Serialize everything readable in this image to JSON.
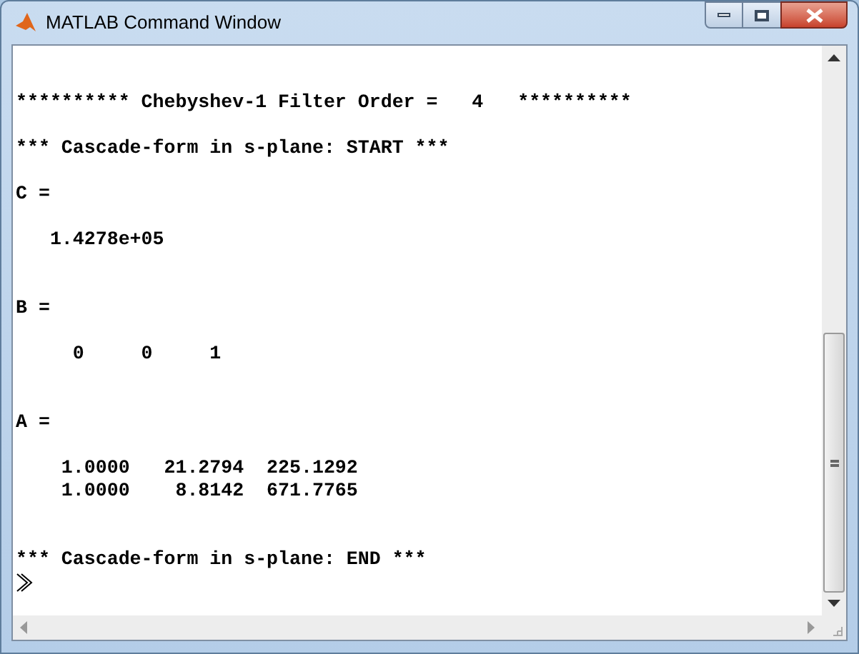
{
  "window": {
    "title": "MATLAB Command Window"
  },
  "console": {
    "lines": [
      {
        "kind": "banner",
        "text": "********** Chebyshev-1 Filter Order =   4   **********"
      },
      {
        "kind": "banner",
        "text": "*** Cascade-form in s-plane: START ***"
      },
      {
        "kind": "label",
        "text": "C ="
      },
      {
        "kind": "value",
        "text": "   1.4278e+05"
      },
      {
        "kind": "label",
        "text": "B ="
      },
      {
        "kind": "value",
        "text": "     0     0     1"
      },
      {
        "kind": "label",
        "text": "A ="
      },
      {
        "kind": "value",
        "text": "    1.0000   21.2794  225.1292"
      },
      {
        "kind": "value",
        "text": "    1.0000    8.8142  671.7765"
      },
      {
        "kind": "banner",
        "text": "*** Cascade-form in s-plane: END ***"
      },
      {
        "kind": "prompt"
      }
    ]
  }
}
